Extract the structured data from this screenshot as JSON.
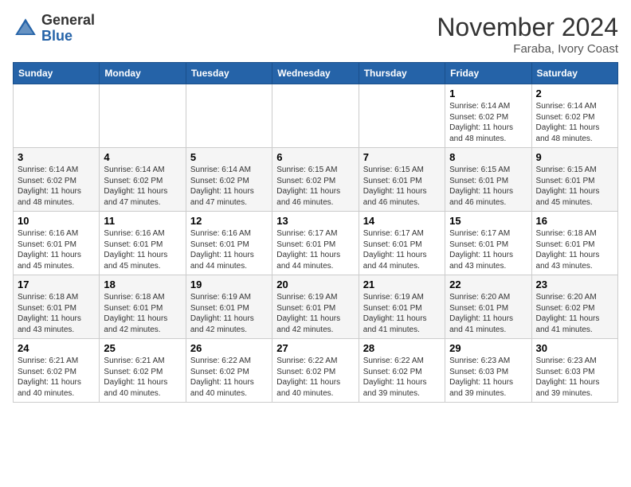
{
  "header": {
    "logo_general": "General",
    "logo_blue": "Blue",
    "month_title": "November 2024",
    "location": "Faraba, Ivory Coast"
  },
  "days_of_week": [
    "Sunday",
    "Monday",
    "Tuesday",
    "Wednesday",
    "Thursday",
    "Friday",
    "Saturday"
  ],
  "weeks": [
    [
      {
        "day": "",
        "info": ""
      },
      {
        "day": "",
        "info": ""
      },
      {
        "day": "",
        "info": ""
      },
      {
        "day": "",
        "info": ""
      },
      {
        "day": "",
        "info": ""
      },
      {
        "day": "1",
        "info": "Sunrise: 6:14 AM\nSunset: 6:02 PM\nDaylight: 11 hours\nand 48 minutes."
      },
      {
        "day": "2",
        "info": "Sunrise: 6:14 AM\nSunset: 6:02 PM\nDaylight: 11 hours\nand 48 minutes."
      }
    ],
    [
      {
        "day": "3",
        "info": "Sunrise: 6:14 AM\nSunset: 6:02 PM\nDaylight: 11 hours\nand 48 minutes."
      },
      {
        "day": "4",
        "info": "Sunrise: 6:14 AM\nSunset: 6:02 PM\nDaylight: 11 hours\nand 47 minutes."
      },
      {
        "day": "5",
        "info": "Sunrise: 6:14 AM\nSunset: 6:02 PM\nDaylight: 11 hours\nand 47 minutes."
      },
      {
        "day": "6",
        "info": "Sunrise: 6:15 AM\nSunset: 6:02 PM\nDaylight: 11 hours\nand 46 minutes."
      },
      {
        "day": "7",
        "info": "Sunrise: 6:15 AM\nSunset: 6:01 PM\nDaylight: 11 hours\nand 46 minutes."
      },
      {
        "day": "8",
        "info": "Sunrise: 6:15 AM\nSunset: 6:01 PM\nDaylight: 11 hours\nand 46 minutes."
      },
      {
        "day": "9",
        "info": "Sunrise: 6:15 AM\nSunset: 6:01 PM\nDaylight: 11 hours\nand 45 minutes."
      }
    ],
    [
      {
        "day": "10",
        "info": "Sunrise: 6:16 AM\nSunset: 6:01 PM\nDaylight: 11 hours\nand 45 minutes."
      },
      {
        "day": "11",
        "info": "Sunrise: 6:16 AM\nSunset: 6:01 PM\nDaylight: 11 hours\nand 45 minutes."
      },
      {
        "day": "12",
        "info": "Sunrise: 6:16 AM\nSunset: 6:01 PM\nDaylight: 11 hours\nand 44 minutes."
      },
      {
        "day": "13",
        "info": "Sunrise: 6:17 AM\nSunset: 6:01 PM\nDaylight: 11 hours\nand 44 minutes."
      },
      {
        "day": "14",
        "info": "Sunrise: 6:17 AM\nSunset: 6:01 PM\nDaylight: 11 hours\nand 44 minutes."
      },
      {
        "day": "15",
        "info": "Sunrise: 6:17 AM\nSunset: 6:01 PM\nDaylight: 11 hours\nand 43 minutes."
      },
      {
        "day": "16",
        "info": "Sunrise: 6:18 AM\nSunset: 6:01 PM\nDaylight: 11 hours\nand 43 minutes."
      }
    ],
    [
      {
        "day": "17",
        "info": "Sunrise: 6:18 AM\nSunset: 6:01 PM\nDaylight: 11 hours\nand 43 minutes."
      },
      {
        "day": "18",
        "info": "Sunrise: 6:18 AM\nSunset: 6:01 PM\nDaylight: 11 hours\nand 42 minutes."
      },
      {
        "day": "19",
        "info": "Sunrise: 6:19 AM\nSunset: 6:01 PM\nDaylight: 11 hours\nand 42 minutes."
      },
      {
        "day": "20",
        "info": "Sunrise: 6:19 AM\nSunset: 6:01 PM\nDaylight: 11 hours\nand 42 minutes."
      },
      {
        "day": "21",
        "info": "Sunrise: 6:19 AM\nSunset: 6:01 PM\nDaylight: 11 hours\nand 41 minutes."
      },
      {
        "day": "22",
        "info": "Sunrise: 6:20 AM\nSunset: 6:01 PM\nDaylight: 11 hours\nand 41 minutes."
      },
      {
        "day": "23",
        "info": "Sunrise: 6:20 AM\nSunset: 6:02 PM\nDaylight: 11 hours\nand 41 minutes."
      }
    ],
    [
      {
        "day": "24",
        "info": "Sunrise: 6:21 AM\nSunset: 6:02 PM\nDaylight: 11 hours\nand 40 minutes."
      },
      {
        "day": "25",
        "info": "Sunrise: 6:21 AM\nSunset: 6:02 PM\nDaylight: 11 hours\nand 40 minutes."
      },
      {
        "day": "26",
        "info": "Sunrise: 6:22 AM\nSunset: 6:02 PM\nDaylight: 11 hours\nand 40 minutes."
      },
      {
        "day": "27",
        "info": "Sunrise: 6:22 AM\nSunset: 6:02 PM\nDaylight: 11 hours\nand 40 minutes."
      },
      {
        "day": "28",
        "info": "Sunrise: 6:22 AM\nSunset: 6:02 PM\nDaylight: 11 hours\nand 39 minutes."
      },
      {
        "day": "29",
        "info": "Sunrise: 6:23 AM\nSunset: 6:03 PM\nDaylight: 11 hours\nand 39 minutes."
      },
      {
        "day": "30",
        "info": "Sunrise: 6:23 AM\nSunset: 6:03 PM\nDaylight: 11 hours\nand 39 minutes."
      }
    ]
  ]
}
